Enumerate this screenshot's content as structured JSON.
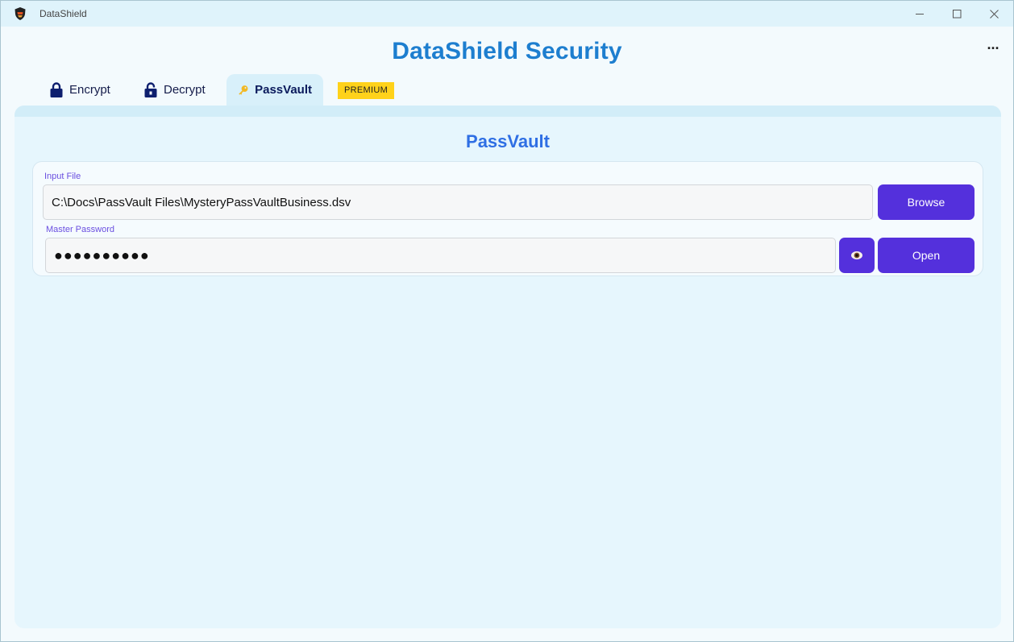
{
  "window": {
    "title": "DataShield",
    "controls": [
      "minimize-icon",
      "maximize-icon",
      "close-icon"
    ]
  },
  "header": {
    "app_title": "DataShield Security",
    "more_label": "..."
  },
  "tabs": [
    {
      "label": "Encrypt",
      "icon": "lock-icon",
      "active": false
    },
    {
      "label": "Decrypt",
      "icon": "unlock-icon",
      "active": false
    },
    {
      "label": "PassVault",
      "icon": "key-icon",
      "active": true
    }
  ],
  "badge": {
    "label": "PREMIUM",
    "color": "#ffd21a"
  },
  "passvault": {
    "title": "PassVault",
    "input_file": {
      "label": "Input File",
      "value": "C:\\Docs\\PassVault Files\\MysteryPassVaultBusiness.dsv"
    },
    "master_password": {
      "label": "Master Password",
      "value": "●●●●●●●●●●"
    },
    "browse_label": "Browse",
    "open_label": "Open",
    "reveal_icon": "eye-icon"
  },
  "colors": {
    "accent": "#5430dc",
    "title": "#1d7ecf",
    "section_title": "#2f6fe4",
    "label": "#6a4fe0"
  }
}
